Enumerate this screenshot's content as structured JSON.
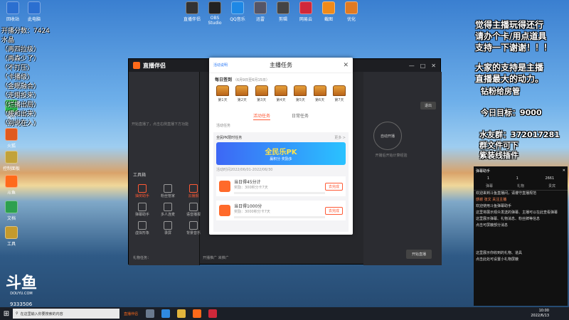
{
  "overlay_left": {
    "score_line": "开播分数：7424",
    "lines": [
      "水晶",
      "（再四拉级）",
      "（再森少了）",
      "（不打压）",
      "（卡播级）",
      "（金眠融合）",
      "（走眼投来）",
      "（烂播出局）",
      "（暖和出来）",
      "（别说在入）"
    ]
  },
  "overlay_right": {
    "line1": "觉得主播玩得还行",
    "line2": "请办个卡/用点道具",
    "line3": "支持一下谢谢！！！",
    "line4": "大家的支持是主播",
    "line5": "直播最大的动力。",
    "line6": "钻粉给房管",
    "target": "今日目标：9000",
    "group": "水友群：372017281",
    "next1": "群文件可下",
    "next2": "紫装线插件"
  },
  "app": {
    "title": "直播伴侣",
    "tool_section": "工具箱",
    "left_hint": "开始直播了，点击右侧直播下方功能",
    "tools": [
      "抽奖助手",
      "粉丝管家",
      "云播报",
      "弹幕助手",
      "多人连麦",
      "语音播报",
      "虚拟形象",
      "录屏",
      "背景音乐"
    ],
    "right_button": "退出",
    "right_circle": "自动开播",
    "right_note": "开播后开始计算经验",
    "bottom_status": "礼物任务：",
    "bottom_bar": "开播推广 来推广",
    "start_button": "开始直播"
  },
  "dialog": {
    "top_link": "活动说明",
    "title": "主播任务",
    "signin_label": "每日签到",
    "signin_range": "（6月9日至6月15日）",
    "days": [
      "第1天",
      "第2天",
      "第3天",
      "第4天",
      "第5天",
      "第6天",
      "第7天"
    ],
    "tabs": [
      "活动任务",
      "日常任务"
    ],
    "section_label": "活动任务",
    "event_title": "全民PK限时任务",
    "event_more": "更多 >",
    "banner_title": "全民乐PK",
    "banner_sub": "赢积分 奖励多",
    "date_line": "活动时间2022/06/01-2022/06/30",
    "tasks": [
      {
        "name": "当日得45分计",
        "desc": "奖励：300积分卡7天",
        "button": "去完成"
      },
      {
        "name": "当日得1000分",
        "desc": "奖励：3000积分卡7天",
        "button": "去完成"
      }
    ]
  },
  "chat": {
    "title": "弹幕助手",
    "stats": [
      "1",
      "1",
      "2661"
    ],
    "tabs": [
      "弹幕",
      "礼物",
      "贵宾"
    ],
    "lines": [
      "欢迎来到斗鱼直播间，请遵守直播规范",
      "感谢 张文 关注主播",
      "欢迎使用斗鱼弹幕助手",
      "这里将展示观众发送的弹幕、主播可以在此查看弹幕",
      "这里展示弹幕、礼物消息、粉丝牌等信息",
      "点击可屏蔽部分消息",
      "这里展示你收到的礼物、道具",
      "点击此处可设置小礼物屏蔽"
    ]
  },
  "desktop": {
    "icons": [
      "回收站",
      "此电脑",
      "网络",
      "微信",
      "火狐",
      "控制面板",
      "斗鱼",
      "文档",
      "工具"
    ],
    "top_icons": [
      "直播伴侣",
      "OBS Studio",
      "QQ音乐",
      "迅雷",
      "剪辑",
      "网易云",
      "截图",
      "优化"
    ],
    "logo": "斗鱼",
    "logo_sub": "DOUYU.COM",
    "room": "9333506"
  },
  "taskbar": {
    "search_placeholder": "在这里输入你要搜索的内容",
    "time": "10:00",
    "date": "2022/6/13",
    "app_label": "直播伴侣"
  }
}
